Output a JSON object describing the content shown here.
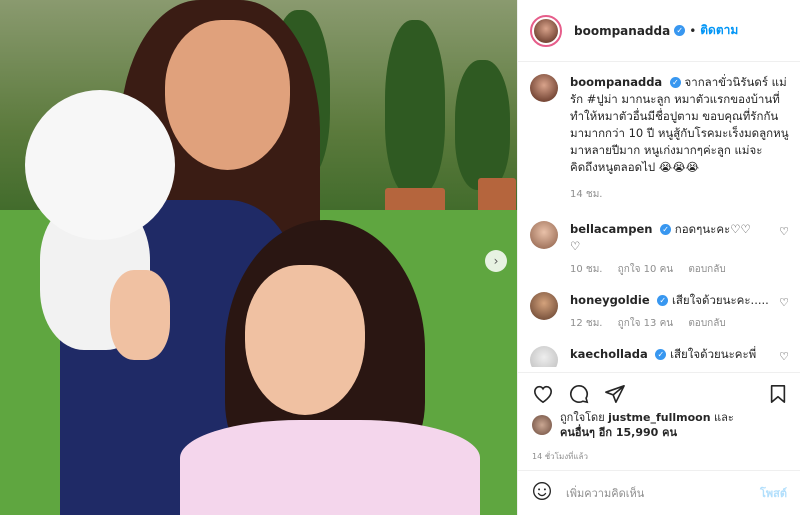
{
  "post": {
    "username": "boompanadda",
    "follow_label": "ติดตาม",
    "caption": "จากลาขั่วนิรันดร์ แม่รัก #ปูม่า มากนะลูก หมาตัวแรกของบ้านที่ทำให้หมาตัวอื่นมีชื่อปูตาม ขอบคุณที่รักกันมามากกว่า 10 ปี หนูสู้กับโรคมะเร็งมดลูกหนูมาหลายปีมาก หนูเก่งมากๆค่ะลูก แม่จะคิดถึงหนูตลอดไป 😭😭😭",
    "caption_time": "14 ชม."
  },
  "comments": [
    {
      "username": "bellacampen",
      "text": "กอดๆนะคะ♡♡\n♡",
      "time": "10 ชม.",
      "likes": "ถูกใจ 10 คน",
      "reply": "ตอบกลับ"
    },
    {
      "username": "honeygoldie",
      "text": "เสียใจด้วยนะคะ.....",
      "time": "12 ชม.",
      "likes": "ถูกใจ 13 คน",
      "reply": "ตอบกลับ"
    },
    {
      "username": "kaechollada",
      "text": "เสียใจด้วยนะคะพี่",
      "time": "",
      "likes": "",
      "reply": ""
    }
  ],
  "likes": {
    "prefix": "ถูกใจโดย",
    "by_user": "justme_fullmoon",
    "and": "และ",
    "others": "คนอื่นๆ อีก 15,990 คน"
  },
  "post_time": "14 ชั่วโมงที่แล้ว",
  "add_comment": {
    "placeholder": "เพิ่มความคิดเห็น",
    "post_label": "โพสต์"
  },
  "colors": {
    "link": "#0095f6",
    "verified": "#3897f0",
    "muted": "#8e8e8e"
  },
  "icons": {
    "heart": "heart-icon",
    "comment": "comment-icon",
    "share": "share-icon",
    "save": "bookmark-icon",
    "emoji": "emoji-icon",
    "next": "chevron-right-icon"
  }
}
